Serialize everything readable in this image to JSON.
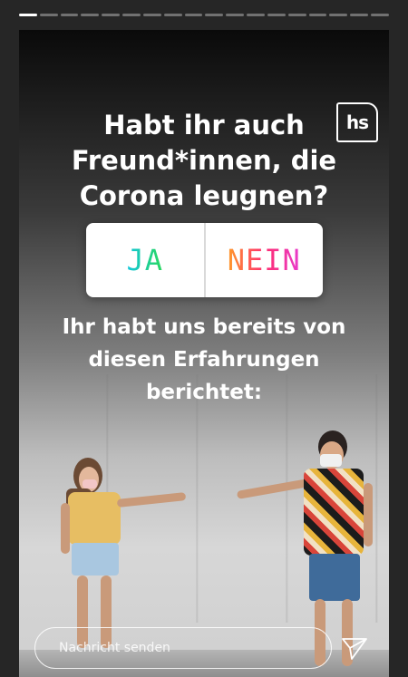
{
  "story": {
    "progress_segments": 18,
    "active_segment": 0,
    "logo_text": "hs",
    "headline": "Habt ihr auch Freund*innen, die Corona leugnen?",
    "poll": {
      "option_yes": "JA",
      "option_no": "NEIN"
    },
    "subtext": "Ihr habt uns bereits von diesen Erfahrungen berichtet:"
  },
  "reply": {
    "placeholder": "Nachricht senden"
  },
  "icons": {
    "send": "paper-plane-icon",
    "logo": "hs-logo-icon"
  }
}
